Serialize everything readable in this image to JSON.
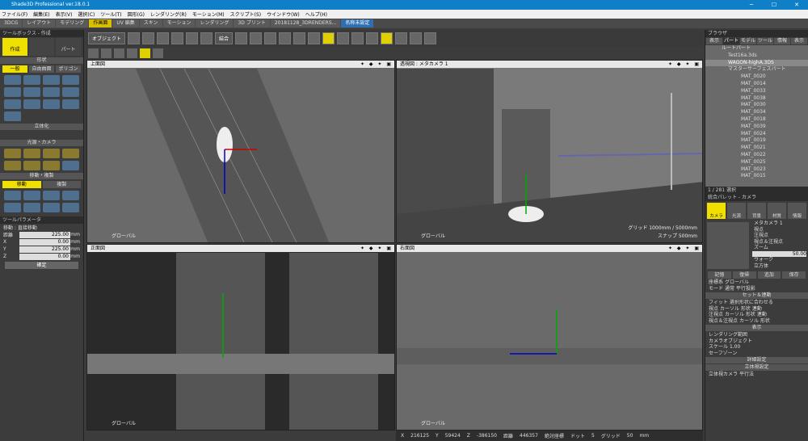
{
  "app": {
    "title": "Shade3D Professional ver.18.0.1"
  },
  "menu": [
    "ファイル(F)",
    "編集(E)",
    "表示(V)",
    "選択(C)",
    "ツール(T)",
    "図形(G)",
    "レンダリング(R)",
    "モーション(M)",
    "スクリプト(S)",
    "ウインドウ(W)",
    "ヘルプ(H)"
  ],
  "tabs": [
    {
      "label": "3DCG"
    },
    {
      "label": "レイアウト"
    },
    {
      "label": "モデリング"
    },
    {
      "label": "作画面"
    },
    {
      "label": "UV 編集"
    },
    {
      "label": "スキン"
    },
    {
      "label": "モーション"
    },
    {
      "label": "レンダリング"
    },
    {
      "label": "3D プリント"
    },
    {
      "label": "20181128_3DRENDERS..."
    },
    {
      "label": "名称未設定"
    }
  ],
  "toolbar": {
    "object_label": "オブジェクト",
    "combine_label": "結合"
  },
  "toolbox": {
    "title": "ツールボックス - 作成",
    "create": "作成",
    "part": "パート",
    "shape_section": "形状",
    "shape_tabs": [
      "一般",
      "自由曲面",
      "ポリゴン"
    ],
    "solid_section": "立体化",
    "light_section": "光源・カメラ",
    "move_section": "移動・複製",
    "move_tabs": [
      "移動",
      "複製"
    ]
  },
  "toolparam": {
    "title": "ツールパラメータ",
    "mode": "移動 : 直接移動",
    "fields": [
      {
        "k": "距離",
        "v": "225.00",
        "u": "mm"
      },
      {
        "k": "X",
        "v": "0.00",
        "u": "mm"
      },
      {
        "k": "Y",
        "v": "225.00",
        "u": "mm"
      },
      {
        "k": "Z",
        "v": "0.00",
        "u": "mm"
      }
    ],
    "confirm": "確定"
  },
  "viewports": {
    "top": "上面図",
    "persp": "透視図 : メタカメラ 1",
    "front": "正面図",
    "right": "右面図",
    "global": "グローバル",
    "grid_info": "グリッド 1000mm / 5000mm",
    "snap_info": "スナップ 500mm"
  },
  "browser": {
    "title": "ブラウザ",
    "tabs": [
      "表示",
      "パート",
      "モデル",
      "ツール",
      "情報",
      "表示"
    ],
    "items": [
      "ルートパート",
      "Test16a.3ds",
      "WAGON-highA.3DS",
      "マスターサーフェスパート",
      "MAT_0020",
      "MAT_0014",
      "MAT_0033",
      "MAT_0038",
      "MAT_0030",
      "MAT_0034",
      "MAT_0018",
      "MAT_0039",
      "MAT_0024",
      "MAT_0019",
      "MAT_0021",
      "MAT_0022",
      "MAT_0025",
      "MAT_0023",
      "MAT_0015"
    ],
    "selected": 2,
    "count": "1 / 281 選択"
  },
  "palette": {
    "title": "統合パレット - カメラ",
    "tabs": [
      "カメラ",
      "光源",
      "背景",
      "材質",
      "情報"
    ],
    "camera": "メタカメラ 1",
    "opts": [
      "視点",
      "注視点",
      "視点＆注視点",
      "ズーム",
      "ウォーク"
    ],
    "zoom": "50.00",
    "stereo": "立方体",
    "record": "記憶",
    "restore": "復帰",
    "add": "追加",
    "save": "保存",
    "coord_label": "座標系",
    "coord": "グローバル",
    "mode_label": "モード",
    "mode": "通常",
    "parallel": "平行投影",
    "sec_set": "セット＆連動",
    "fit": "フィット",
    "fit_btn": "選択形状に合わせる",
    "rows": [
      "視点",
      "注視点",
      "視点＆注視点"
    ],
    "cursor": "カーソル",
    "shape": "形状",
    "link": "連動",
    "sec_display": "表示",
    "rendering_range": "レンダリング範囲",
    "camera_obj": "カメラオブジェクト",
    "scale_label": "スケール",
    "scale": "1.00",
    "safe_zone": "セーフゾーン",
    "sec_detail": "詳細設定",
    "sec_stereo": "立体視設定",
    "stereo_camera": "立体視カメラ",
    "parallel_method": "平行法"
  },
  "status": {
    "x": "X",
    "xv": "216125",
    "y": "Y",
    "yv": "59424",
    "z": "Z",
    "zv": "-386150",
    "dist": "距離",
    "dv": "446357",
    "mode": "絶対座標",
    "dot": "ドット",
    "dotv": "5",
    "grid": "グリッド",
    "gridv": "50",
    "unit": "mm"
  }
}
